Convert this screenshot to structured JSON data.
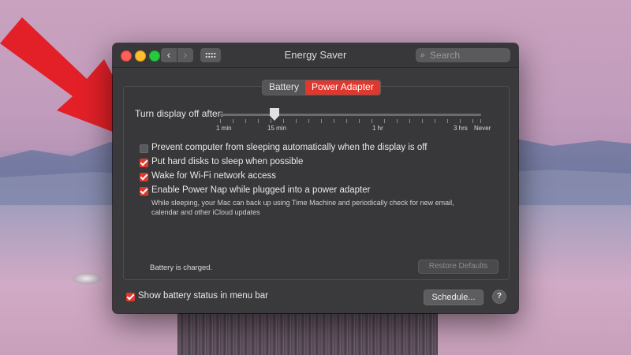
{
  "window": {
    "title": "Energy Saver",
    "search_placeholder": "Search",
    "nav_back": "‹",
    "nav_forward": "›"
  },
  "tabs": [
    {
      "label": "Battery",
      "active": false
    },
    {
      "label": "Power Adapter",
      "active": true
    }
  ],
  "slider": {
    "label": "Turn display off after:",
    "value": "15 min",
    "tick_labels": [
      "1 min",
      "15 min",
      "1 hr",
      "3 hrs",
      "Never"
    ]
  },
  "options": [
    {
      "label": "Prevent computer from sleeping automatically when the display is off",
      "checked": false
    },
    {
      "label": "Put hard disks to sleep when possible",
      "checked": true
    },
    {
      "label": "Wake for Wi-Fi network access",
      "checked": true
    },
    {
      "label": "Enable Power Nap while plugged into a power adapter",
      "checked": true
    }
  ],
  "power_nap_description": "While sleeping, your Mac can back up using Time Machine and periodically check for new email, calendar and other iCloud updates",
  "battery_status": "Battery is charged.",
  "restore_defaults_label": "Restore Defaults",
  "show_battery_status": {
    "label": "Show battery status in menu bar",
    "checked": true
  },
  "schedule_label": "Schedule...",
  "help_label": "?",
  "colors": {
    "accent": "#e0382e",
    "window_bg": "#3a3a3c",
    "arrow": "#e32028"
  }
}
